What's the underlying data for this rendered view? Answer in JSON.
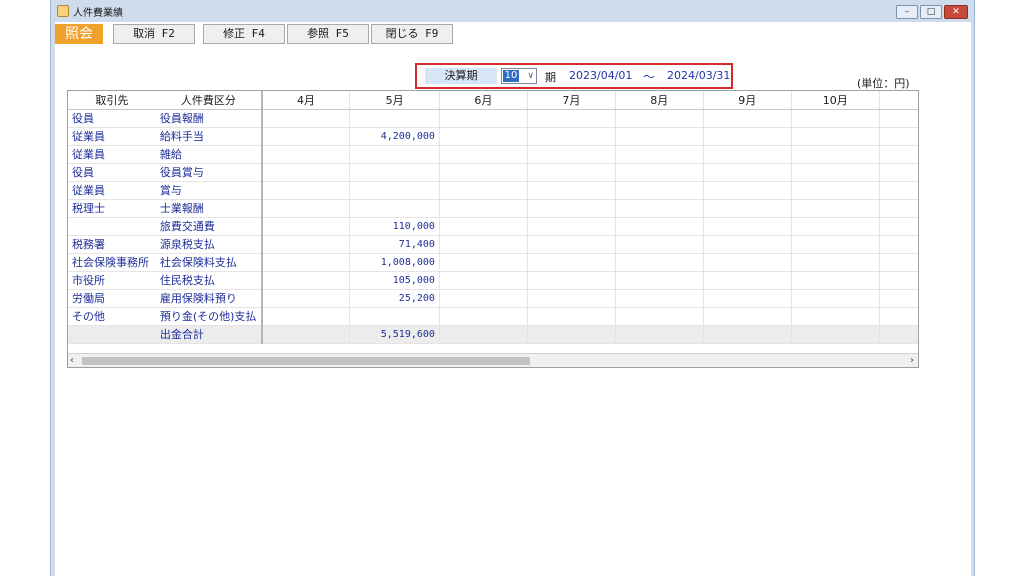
{
  "window": {
    "title": "人件費業績"
  },
  "toolbar": {
    "active_label": "照会",
    "buttons": [
      "取消 F2",
      "修正 F4",
      "参照 F5",
      "閉じる F9"
    ]
  },
  "period": {
    "label": "決算期",
    "selected": "10",
    "suffix": "期",
    "from": "2023/04/01",
    "tilde": "～",
    "to": "2024/03/31"
  },
  "unit": "(単位：円)",
  "table": {
    "headers": [
      "取引先",
      "人件費区分",
      "4月",
      "5月",
      "6月",
      "7月",
      "8月",
      "9月",
      "10月"
    ],
    "rows": [
      {
        "party": "役員",
        "category": "役員報酬",
        "v": [
          "",
          "",
          "",
          "",
          "",
          "",
          ""
        ]
      },
      {
        "party": "従業員",
        "category": "給料手当",
        "v": [
          "",
          "4,200,000",
          "",
          "",
          "",
          "",
          ""
        ]
      },
      {
        "party": "従業員",
        "category": "雑給",
        "v": [
          "",
          "",
          "",
          "",
          "",
          "",
          ""
        ]
      },
      {
        "party": "役員",
        "category": "役員賞与",
        "v": [
          "",
          "",
          "",
          "",
          "",
          "",
          ""
        ]
      },
      {
        "party": "従業員",
        "category": "賞与",
        "v": [
          "",
          "",
          "",
          "",
          "",
          "",
          ""
        ]
      },
      {
        "party": "税理士",
        "category": "士業報酬",
        "v": [
          "",
          "",
          "",
          "",
          "",
          "",
          ""
        ]
      },
      {
        "party": "",
        "category": "旅費交通費",
        "v": [
          "",
          "110,000",
          "",
          "",
          "",
          "",
          ""
        ]
      },
      {
        "party": "税務署",
        "category": "源泉税支払",
        "v": [
          "",
          "71,400",
          "",
          "",
          "",
          "",
          ""
        ]
      },
      {
        "party": "社会保険事務所",
        "category": "社会保険料支払",
        "v": [
          "",
          "1,008,000",
          "",
          "",
          "",
          "",
          ""
        ]
      },
      {
        "party": "市役所",
        "category": "住民税支払",
        "v": [
          "",
          "105,000",
          "",
          "",
          "",
          "",
          ""
        ]
      },
      {
        "party": "労働局",
        "category": "雇用保険料預り",
        "v": [
          "",
          "25,200",
          "",
          "",
          "",
          "",
          ""
        ]
      },
      {
        "party": "その他",
        "category": "預り金(その他)支払",
        "v": [
          "",
          "",
          "",
          "",
          "",
          "",
          ""
        ]
      }
    ],
    "total": {
      "party": "",
      "category": "出金合計",
      "v": [
        "",
        "5,519,600",
        "",
        "",
        "",
        "",
        ""
      ]
    }
  },
  "scrollbar": {
    "left_arrow": "‹",
    "right_arrow": "›"
  },
  "icons": {
    "app": "app-icon",
    "minimize": "minimize-icon",
    "maximize": "maximize-icon",
    "close": "close-icon"
  }
}
